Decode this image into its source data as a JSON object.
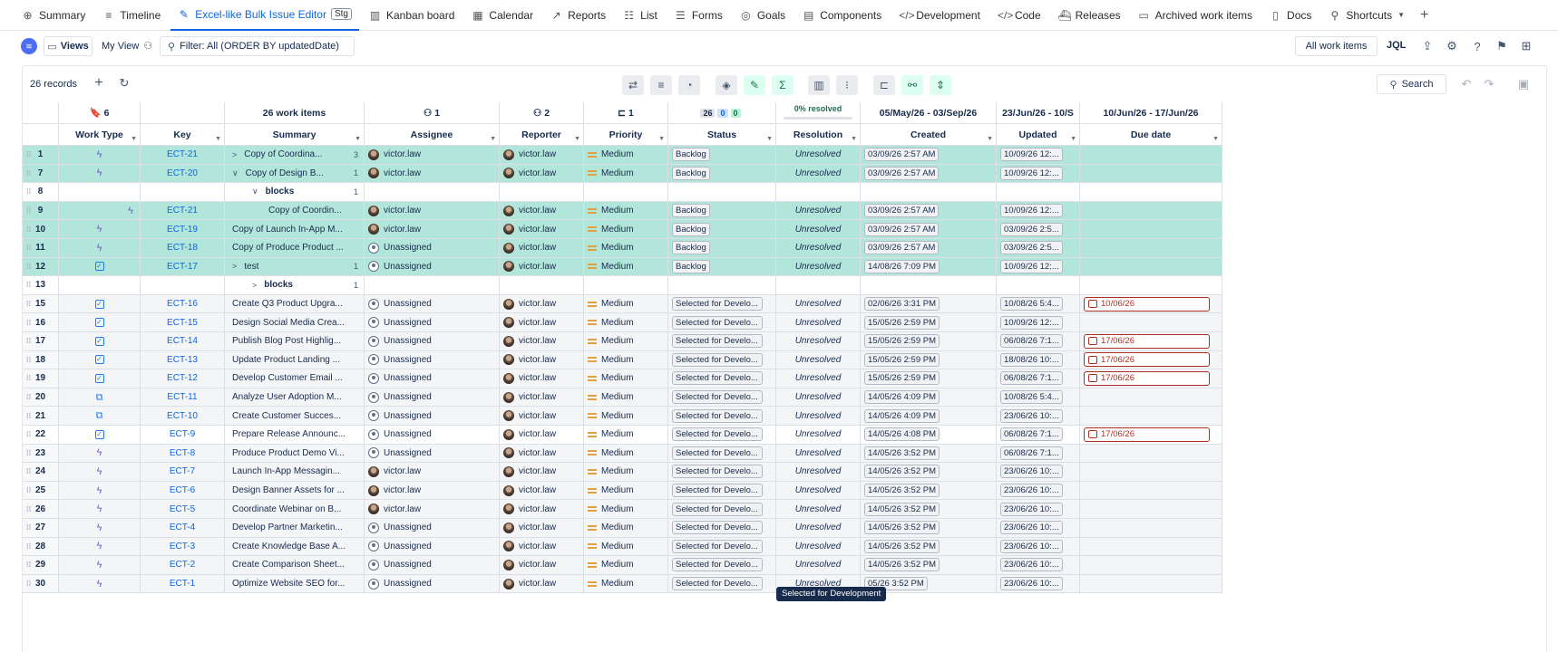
{
  "nav": {
    "tabs": [
      {
        "label": "Summary",
        "icon": "globe-icon",
        "glyph": "⊕"
      },
      {
        "label": "Timeline",
        "icon": "timeline-icon",
        "glyph": "≡"
      },
      {
        "label": "Excel-like Bulk Issue Editor",
        "icon": "bulk-editor-icon",
        "glyph": "✎",
        "badge": "Stg",
        "active": true
      },
      {
        "label": "Kanban board",
        "icon": "board-icon",
        "glyph": "▥"
      },
      {
        "label": "Calendar",
        "icon": "calendar-icon",
        "glyph": "▦"
      },
      {
        "label": "Reports",
        "icon": "reports-icon",
        "glyph": "↗"
      },
      {
        "label": "List",
        "icon": "list-icon",
        "glyph": "☷"
      },
      {
        "label": "Forms",
        "icon": "forms-icon",
        "glyph": "☰"
      },
      {
        "label": "Goals",
        "icon": "goals-icon",
        "glyph": "◎"
      },
      {
        "label": "Components",
        "icon": "components-icon",
        "glyph": "▤"
      },
      {
        "label": "Development",
        "icon": "development-icon",
        "glyph": "</>"
      },
      {
        "label": "Code",
        "icon": "code-icon",
        "glyph": "</>"
      },
      {
        "label": "Releases",
        "icon": "releases-icon",
        "glyph": "⛴"
      },
      {
        "label": "Archived work items",
        "icon": "archive-icon",
        "glyph": "▭"
      },
      {
        "label": "Docs",
        "icon": "docs-icon",
        "glyph": "▯"
      },
      {
        "label": "Shortcuts",
        "icon": "link-icon",
        "glyph": "⚲",
        "dropdown": true
      }
    ]
  },
  "toolbar": {
    "views_label": "Views",
    "myview_label": "My View",
    "filter_label": "Filter: All (ORDER BY updatedDate)",
    "all_items_label": "All work items",
    "jql_label": "JQL"
  },
  "records": {
    "count_label": "26 records",
    "search_label": "Search"
  },
  "groups": {
    "work_type_count": "6",
    "summary_count": "26 work items",
    "assignee_count": "1",
    "reporter_count": "2",
    "priority_count": "1",
    "status_counts": [
      "26",
      "0",
      "0"
    ],
    "resolved_label": "0% resolved",
    "created_range": "05/May/26 - 03/Sep/26",
    "updated_range": "23/Jun/26 - 10/S",
    "due_range": "10/Jun/26 - 17/Jun/26"
  },
  "columns": [
    "Work Type",
    "Key",
    "Summary",
    "Assignee",
    "Reporter",
    "Priority",
    "Status",
    "Resolution",
    "Created",
    "Updated",
    "Due date"
  ],
  "rows": [
    {
      "num": "1",
      "type": "epic",
      "key": "ECT-21",
      "summary": "Copy of Coordina...",
      "expander": ">",
      "children": "3",
      "assignee": "victor.law",
      "assignee_photo": true,
      "reporter": "victor.law",
      "priority": "Medium",
      "status": "Backlog",
      "resolution": "Unresolved",
      "created": "03/09/26 2:57 AM",
      "updated": "10/09/26 12:...",
      "due": "",
      "style": "sel"
    },
    {
      "num": "7",
      "type": "epic",
      "key": "ECT-20",
      "summary": "Copy of Design B...",
      "expander": "∨",
      "children": "1",
      "assignee": "victor.law",
      "assignee_photo": true,
      "reporter": "victor.law",
      "priority": "Medium",
      "status": "Backlog",
      "resolution": "Unresolved",
      "created": "03/09/26 2:57 AM",
      "updated": "10/09/26 12:...",
      "due": "",
      "style": "sel"
    },
    {
      "num": "8",
      "blocks": true,
      "label": "blocks",
      "expander": "∨",
      "children": "1"
    },
    {
      "num": "9",
      "type": "epic",
      "key": "ECT-21",
      "summary": "Copy of Coordin...",
      "indent": true,
      "assignee": "victor.law",
      "assignee_photo": true,
      "reporter": "victor.law",
      "priority": "Medium",
      "status": "Backlog",
      "resolution": "Unresolved",
      "created": "03/09/26 2:57 AM",
      "updated": "10/09/26 12:...",
      "due": "",
      "style": "sel"
    },
    {
      "num": "10",
      "type": "epic",
      "key": "ECT-19",
      "summary": "Copy of Launch In-App M...",
      "assignee": "victor.law",
      "assignee_photo": true,
      "reporter": "victor.law",
      "priority": "Medium",
      "status": "Backlog",
      "resolution": "Unresolved",
      "created": "03/09/26 2:57 AM",
      "updated": "03/09/26 2:5...",
      "due": "",
      "style": "sel"
    },
    {
      "num": "11",
      "type": "epic",
      "key": "ECT-18",
      "summary": "Copy of Produce Product ...",
      "assignee": "Unassigned",
      "assignee_photo": false,
      "reporter": "victor.law",
      "priority": "Medium",
      "status": "Backlog",
      "resolution": "Unresolved",
      "created": "03/09/26 2:57 AM",
      "updated": "03/09/26 2:5...",
      "due": "",
      "style": "sel"
    },
    {
      "num": "12",
      "type": "task",
      "key": "ECT-17",
      "summary": "test",
      "expander": ">",
      "children": "1",
      "assignee": "Unassigned",
      "assignee_photo": false,
      "reporter": "victor.law",
      "priority": "Medium",
      "status": "Backlog",
      "resolution": "Unresolved",
      "created": "14/08/26 7:09 PM",
      "updated": "10/09/26 12:...",
      "due": "",
      "style": "sel"
    },
    {
      "num": "13",
      "blocks": true,
      "label": "blocks",
      "expander": ">",
      "children": "1"
    },
    {
      "num": "15",
      "type": "task",
      "key": "ECT-16",
      "summary": "Create Q3 Product Upgra...",
      "assignee": "Unassigned",
      "assignee_photo": false,
      "reporter": "victor.law",
      "priority": "Medium",
      "status": "Selected for Develo...",
      "resolution": "Unresolved",
      "created": "02/06/26 3:31 PM",
      "updated": "10/08/26 5:4...",
      "due": "10/06/26",
      "style": "gray"
    },
    {
      "num": "16",
      "type": "task",
      "key": "ECT-15",
      "summary": "Design Social Media Crea...",
      "assignee": "Unassigned",
      "assignee_photo": false,
      "reporter": "victor.law",
      "priority": "Medium",
      "status": "Selected for Develo...",
      "resolution": "Unresolved",
      "created": "15/05/26 2:59 PM",
      "updated": "10/09/26 12:...",
      "due": "",
      "style": "gray"
    },
    {
      "num": "17",
      "type": "task",
      "key": "ECT-14",
      "summary": "Publish Blog Post Highlig...",
      "assignee": "Unassigned",
      "assignee_photo": false,
      "reporter": "victor.law",
      "priority": "Medium",
      "status": "Selected for Develo...",
      "resolution": "Unresolved",
      "created": "15/05/26 2:59 PM",
      "updated": "06/08/26 7:1...",
      "due": "17/06/26",
      "style": "gray"
    },
    {
      "num": "18",
      "type": "task",
      "key": "ECT-13",
      "summary": "Update Product Landing ...",
      "assignee": "Unassigned",
      "assignee_photo": false,
      "reporter": "victor.law",
      "priority": "Medium",
      "status": "Selected for Develo...",
      "resolution": "Unresolved",
      "created": "15/05/26 2:59 PM",
      "updated": "18/08/26 10:...",
      "due": "17/06/26",
      "style": "gray"
    },
    {
      "num": "19",
      "type": "task",
      "key": "ECT-12",
      "summary": "Develop Customer Email ...",
      "assignee": "Unassigned",
      "assignee_photo": false,
      "reporter": "victor.law",
      "priority": "Medium",
      "status": "Selected for Develo...",
      "resolution": "Unresolved",
      "created": "15/05/26 2:59 PM",
      "updated": "06/08/26 7:1...",
      "due": "17/06/26",
      "style": "gray"
    },
    {
      "num": "20",
      "type": "subtask",
      "key": "ECT-11",
      "summary": "Analyze User Adoption M...",
      "assignee": "Unassigned",
      "assignee_photo": false,
      "reporter": "victor.law",
      "priority": "Medium",
      "status": "Selected for Develo...",
      "resolution": "Unresolved",
      "created": "14/05/26 4:09 PM",
      "updated": "10/08/26 5:4...",
      "due": "",
      "style": "gray"
    },
    {
      "num": "21",
      "type": "subtask",
      "key": "ECT-10",
      "summary": "Create Customer Succes...",
      "assignee": "Unassigned",
      "assignee_photo": false,
      "reporter": "victor.law",
      "priority": "Medium",
      "status": "Selected for Develo...",
      "resolution": "Unresolved",
      "created": "14/05/26 4:09 PM",
      "updated": "23/06/26 10:...",
      "due": "",
      "style": "gray"
    },
    {
      "num": "22",
      "type": "task",
      "key": "ECT-9",
      "summary": "Prepare Release Announc...",
      "assignee": "Unassigned",
      "assignee_photo": false,
      "reporter": "victor.law",
      "priority": "Medium",
      "status": "Selected for Develo...",
      "resolution": "Unresolved",
      "created": "14/05/26 4:08 PM",
      "updated": "06/08/26 7:1...",
      "due": "17/06/26",
      "style": "white"
    },
    {
      "num": "23",
      "type": "epic",
      "key": "ECT-8",
      "summary": "Produce Product Demo Vi...",
      "assignee": "Unassigned",
      "assignee_photo": false,
      "reporter": "victor.law",
      "priority": "Medium",
      "status": "Selected for Develo...",
      "resolution": "Unresolved",
      "created": "14/05/26 3:52 PM",
      "updated": "06/08/26 7:1...",
      "due": "",
      "style": "gray"
    },
    {
      "num": "24",
      "type": "epic",
      "key": "ECT-7",
      "summary": "Launch In-App Messagin...",
      "assignee": "victor.law",
      "assignee_photo": true,
      "reporter": "victor.law",
      "priority": "Medium",
      "status": "Selected for Develo...",
      "resolution": "Unresolved",
      "created": "14/05/26 3:52 PM",
      "updated": "23/06/26 10:...",
      "due": "",
      "style": "gray"
    },
    {
      "num": "25",
      "type": "epic",
      "key": "ECT-6",
      "summary": "Design Banner Assets for ...",
      "assignee": "victor.law",
      "assignee_photo": true,
      "reporter": "victor.law",
      "priority": "Medium",
      "status": "Selected for Develo...",
      "resolution": "Unresolved",
      "created": "14/05/26 3:52 PM",
      "updated": "23/06/26 10:...",
      "due": "",
      "style": "gray"
    },
    {
      "num": "26",
      "type": "epic",
      "key": "ECT-5",
      "summary": "Coordinate Webinar on B...",
      "assignee": "victor.law",
      "assignee_photo": true,
      "reporter": "victor.law",
      "priority": "Medium",
      "status": "Selected for Develo...",
      "resolution": "Unresolved",
      "created": "14/05/26 3:52 PM",
      "updated": "23/06/26 10:...",
      "due": "",
      "style": "gray"
    },
    {
      "num": "27",
      "type": "epic",
      "key": "ECT-4",
      "summary": "Develop Partner Marketin...",
      "assignee": "Unassigned",
      "assignee_photo": false,
      "reporter": "victor.law",
      "priority": "Medium",
      "status": "Selected for Develo...",
      "resolution": "Unresolved",
      "created": "14/05/26 3:52 PM",
      "updated": "23/06/26 10:...",
      "due": "",
      "style": "gray"
    },
    {
      "num": "28",
      "type": "epic",
      "key": "ECT-3",
      "summary": "Create Knowledge Base A...",
      "assignee": "Unassigned",
      "assignee_photo": false,
      "reporter": "victor.law",
      "priority": "Medium",
      "status": "Selected for Develo...",
      "resolution": "Unresolved",
      "created": "14/05/26 3:52 PM",
      "updated": "23/06/26 10:...",
      "due": "",
      "style": "gray"
    },
    {
      "num": "29",
      "type": "epic",
      "key": "ECT-2",
      "summary": "Create Comparison Sheet...",
      "assignee": "Unassigned",
      "assignee_photo": false,
      "reporter": "victor.law",
      "priority": "Medium",
      "status": "Selected for Develo...",
      "resolution": "Unresolved",
      "created": "14/05/26 3:52 PM",
      "updated": "23/06/26 10:...",
      "due": "",
      "style": "gray"
    },
    {
      "num": "30",
      "type": "epic",
      "key": "ECT-1",
      "summary": "Optimize Website SEO for...",
      "assignee": "Unassigned",
      "assignee_photo": false,
      "reporter": "victor.law",
      "priority": "Medium",
      "status": "Selected for Develo...",
      "resolution": "Unresolved",
      "created": "05/26 3:52 PM",
      "updated": "23/06/26 10:...",
      "due": "",
      "style": "gray"
    }
  ],
  "tooltip": "Selected for Development",
  "colors": {
    "accent": "#0c66e4",
    "selected_row": "#b3e6da",
    "due_overdue": "#ae2e24",
    "epic": "#6e5dc6",
    "priority_medium": "#e2a03f"
  }
}
